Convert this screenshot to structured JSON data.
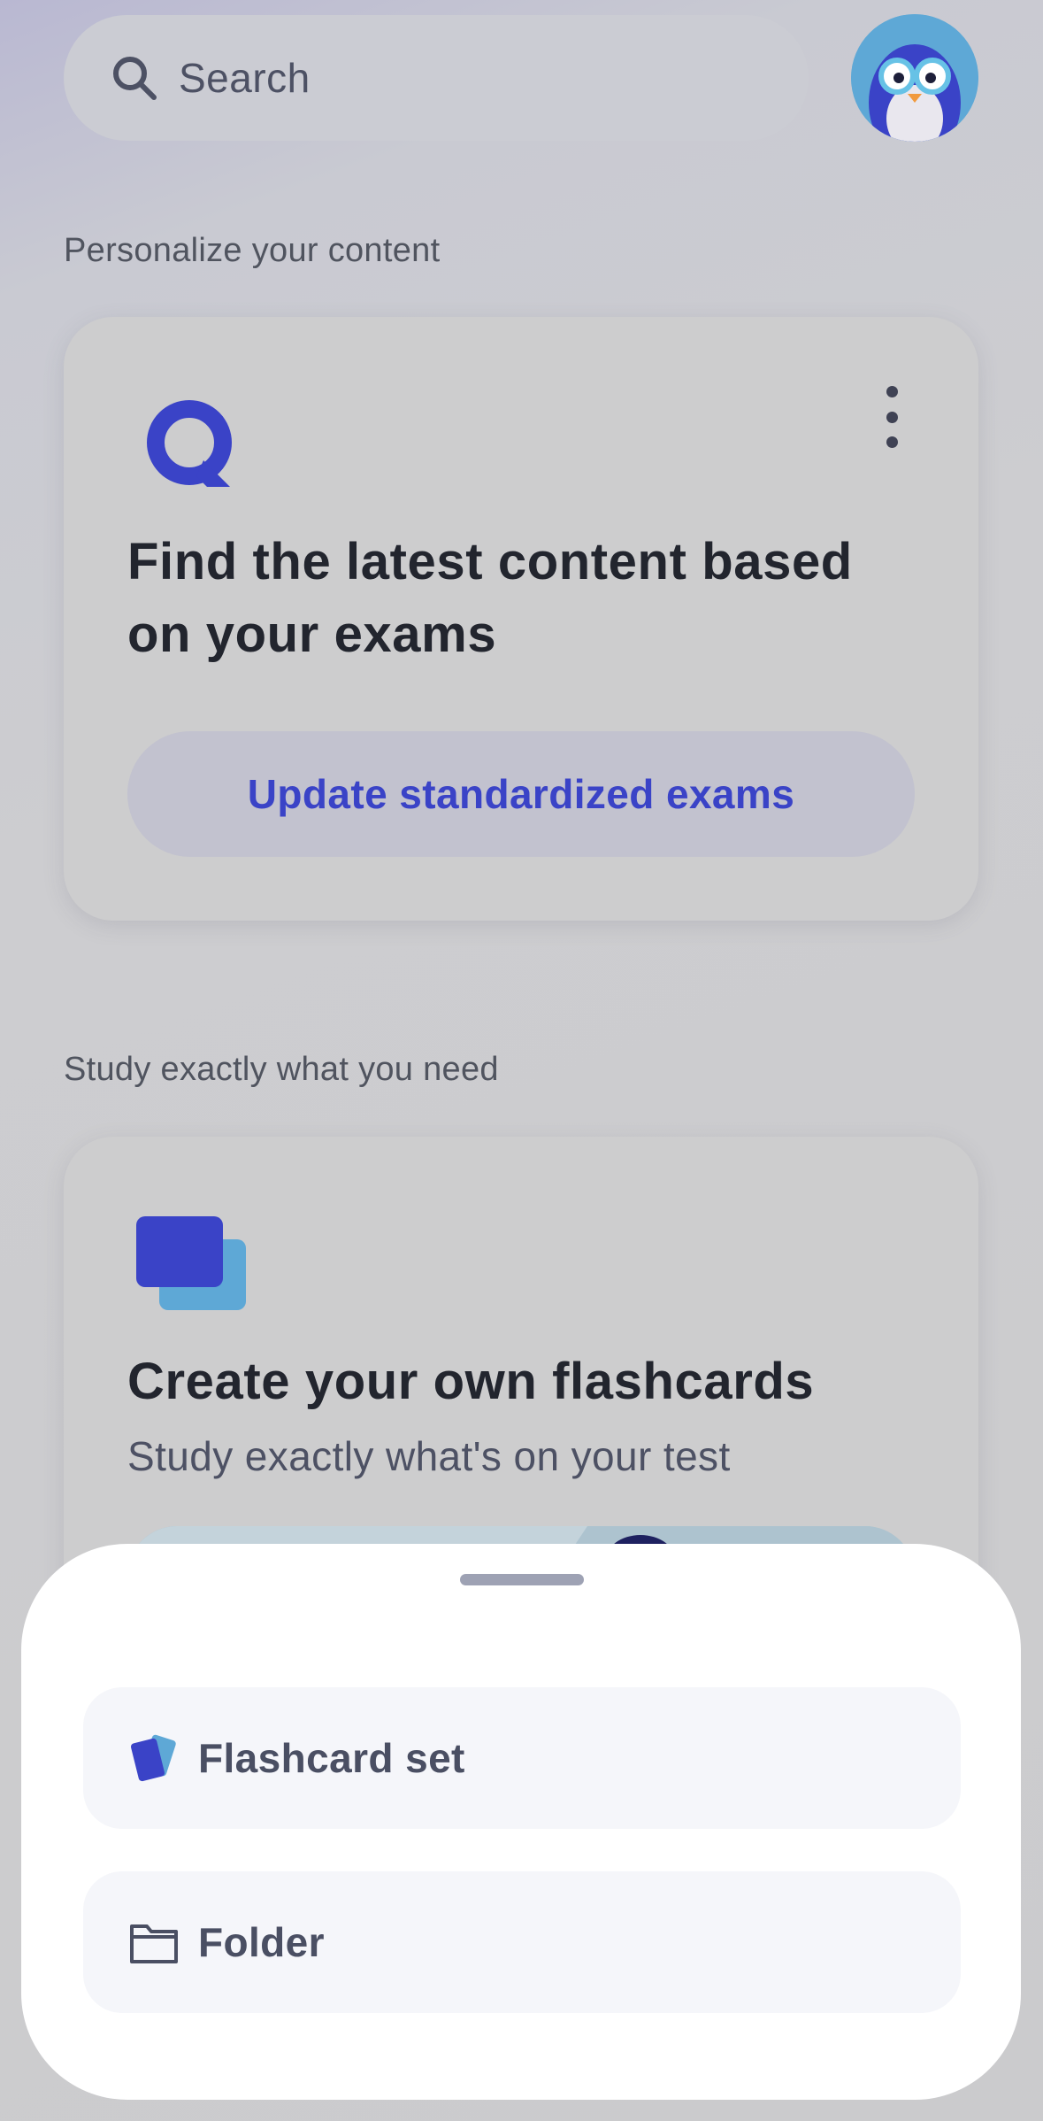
{
  "search": {
    "placeholder": "Search",
    "icon": "search-icon"
  },
  "profile": {
    "avatar": "penguin-avatar"
  },
  "sections": {
    "personalize": {
      "label": "Personalize your content",
      "card": {
        "title": "Find the latest content based on your exams",
        "button_label": "Update standardized exams",
        "icon": "quizlet-logo"
      }
    },
    "study": {
      "label": "Study exactly what you need",
      "card": {
        "title": "Create your own flashcards",
        "subtitle": "Study exactly what's on your test",
        "icon": "flashcards-icon"
      }
    }
  },
  "sheet": {
    "options": [
      {
        "label": "Flashcard set",
        "icon": "flashcard-set-icon"
      },
      {
        "label": "Folder",
        "icon": "folder-icon"
      }
    ]
  },
  "colors": {
    "accent": "#3a43c7",
    "sheet_bg": "#ffffff",
    "option_bg": "#f5f6fa"
  }
}
